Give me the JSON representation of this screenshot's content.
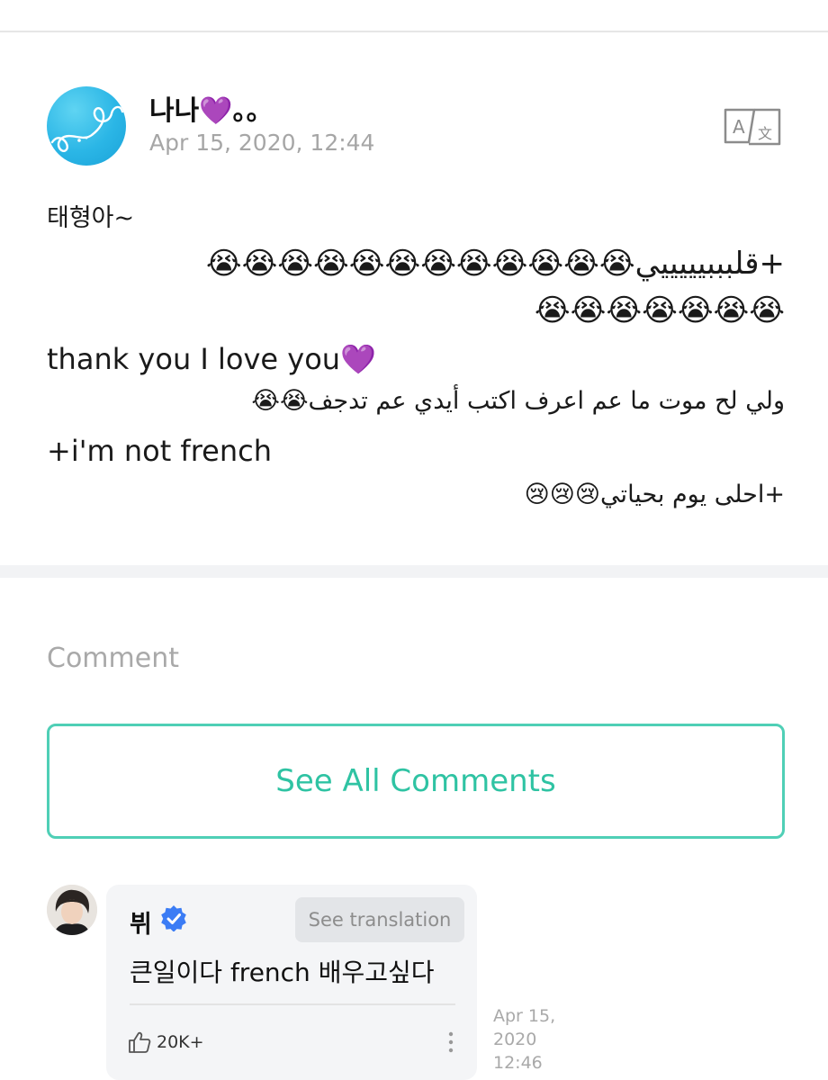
{
  "post": {
    "author": "나나💜。。",
    "date": "Apr 15, 2020, 12:44",
    "lines": [
      {
        "text": "태형아~",
        "dir": "ltr"
      },
      {
        "text": "+قلبببيييييي😭😭😭😭😭😭😭😭😭😭😭😭",
        "dir": "rtl"
      },
      {
        "text": "😭😭😭😭😭😭😭",
        "dir": "rtl"
      },
      {
        "text": "thank you I love you💜",
        "dir": "ltr"
      },
      {
        "text": "ولي لح موت ما عم اعرف اكتب أيدي عم تدجف😭😭",
        "dir": "rtl"
      },
      {
        "text": "+i'm not french",
        "dir": "ltr"
      },
      {
        "text": "+احلى يوم بحياتي😢😢😢",
        "dir": "rtl"
      }
    ]
  },
  "comments_section": {
    "title": "Comment",
    "see_all_label": "See All Comments"
  },
  "comment": {
    "author": "뷔",
    "see_translation_label": "See translation",
    "text": "큰일이다 french 배우고싶다",
    "likes": "20K+",
    "date_lines": [
      "Apr 15,",
      "2020",
      "12:46"
    ]
  },
  "colors": {
    "accent": "#2fc3a3",
    "accent_border": "#4fcfb6",
    "muted_text": "#a6a6a6",
    "verified_blue": "#3b7cf5"
  },
  "icons": [
    "translate-icon",
    "verified-badge-icon",
    "like-thumb-icon",
    "more-vertical-icon"
  ]
}
